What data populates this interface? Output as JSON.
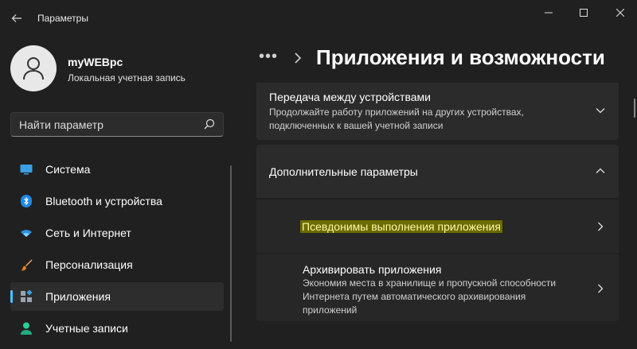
{
  "window": {
    "title": "Параметры"
  },
  "user": {
    "name": "myWEBpc",
    "account_type": "Локальная учетная запись"
  },
  "search": {
    "placeholder": "Найти параметр"
  },
  "sidebar": {
    "items": [
      {
        "label": "Система",
        "icon": "monitor-icon",
        "active": false
      },
      {
        "label": "Bluetooth и устройства",
        "icon": "bluetooth-icon",
        "active": false
      },
      {
        "label": "Сеть и Интернет",
        "icon": "wifi-icon",
        "active": false
      },
      {
        "label": "Персонализация",
        "icon": "brush-icon",
        "active": false
      },
      {
        "label": "Приложения",
        "icon": "apps-icon",
        "active": true
      },
      {
        "label": "Учетные записи",
        "icon": "person-icon",
        "active": false
      }
    ]
  },
  "breadcrumb": {
    "overflow": "•••",
    "title": "Приложения и возможности"
  },
  "cards": {
    "transfer": {
      "title": "Передача между устройствами",
      "description": "Продолжайте работу приложений на других устройствах, подключенных к вашей учетной записи",
      "state": "collapsed"
    },
    "advanced": {
      "title": "Дополнительные параметры",
      "state": "expanded"
    },
    "aliases": {
      "title": "Псевдонимы выполнения приложения",
      "highlighted": true
    },
    "archive": {
      "title": "Архивировать приложения",
      "description": "Экономия места в хранилище и пропускной способности Интернета путем автоматического архивирования приложений"
    }
  },
  "colors": {
    "background": "#202020",
    "card": "#2b2b2b",
    "accent": "#4cc2ff",
    "highlight": "#6b6b00"
  }
}
